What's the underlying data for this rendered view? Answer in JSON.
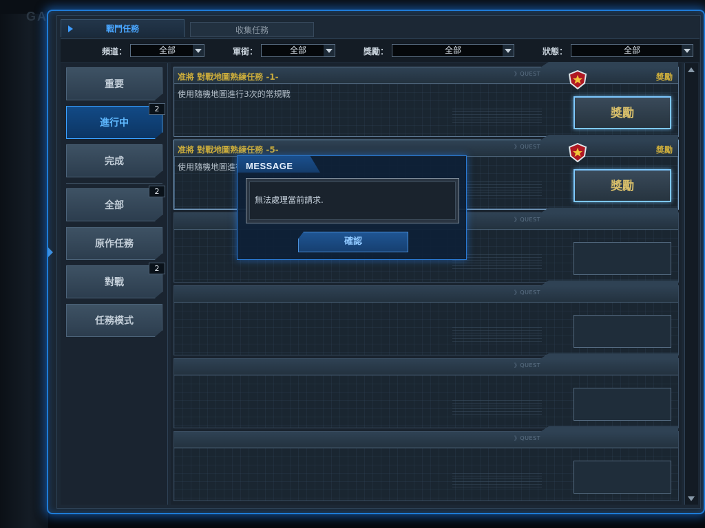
{
  "background": {
    "logo": "GA"
  },
  "tabs": [
    {
      "label": "戰鬥任務",
      "active": true
    },
    {
      "label": "收集任務",
      "active": false
    }
  ],
  "filters": [
    {
      "label": "頻道：",
      "value": "全部"
    },
    {
      "label": "軍銜：",
      "value": "全部"
    },
    {
      "label": "獎勵：",
      "value": "全部"
    },
    {
      "label": "狀態：",
      "value": "全部"
    }
  ],
  "sidebar": {
    "items": [
      {
        "label": "重要",
        "badge": ""
      },
      {
        "label": "進行中",
        "badge": "2",
        "active": true
      },
      {
        "label": "完成",
        "badge": ""
      },
      {
        "label": "全部",
        "badge": "2"
      },
      {
        "label": "原作任務",
        "badge": ""
      },
      {
        "label": "對戰",
        "badge": "2"
      },
      {
        "label": "任務模式",
        "badge": ""
      }
    ]
  },
  "quests": [
    {
      "title": "准將  對戰地圖熟練任務  -1-",
      "desc": "使用隨機地圖進行3次的常規戰",
      "tag": "》QUEST",
      "reward_label": "獎勵",
      "button": "獎勵"
    },
    {
      "title": "准將  對戰地圖熟練任務  -5-",
      "desc": "使用隨機地圖進行",
      "tag": "》QUEST",
      "reward_label": "獎勵",
      "button": "獎勵"
    },
    {
      "title": "",
      "desc": "",
      "tag": "》QUEST",
      "reward_label": "",
      "button": ""
    },
    {
      "title": "",
      "desc": "",
      "tag": "》QUEST",
      "reward_label": "",
      "button": ""
    },
    {
      "title": "",
      "desc": "",
      "tag": "》QUEST",
      "reward_label": "",
      "button": ""
    },
    {
      "title": "",
      "desc": "",
      "tag": "》QUEST",
      "reward_label": "",
      "button": ""
    }
  ],
  "dialog": {
    "title": "MESSAGE",
    "message": "無法處理當前請求.",
    "confirm": "確認"
  },
  "colors": {
    "accent": "#1e7bd6",
    "gold_text": "#c9ab3c",
    "active_blue": "#49a6ff"
  }
}
